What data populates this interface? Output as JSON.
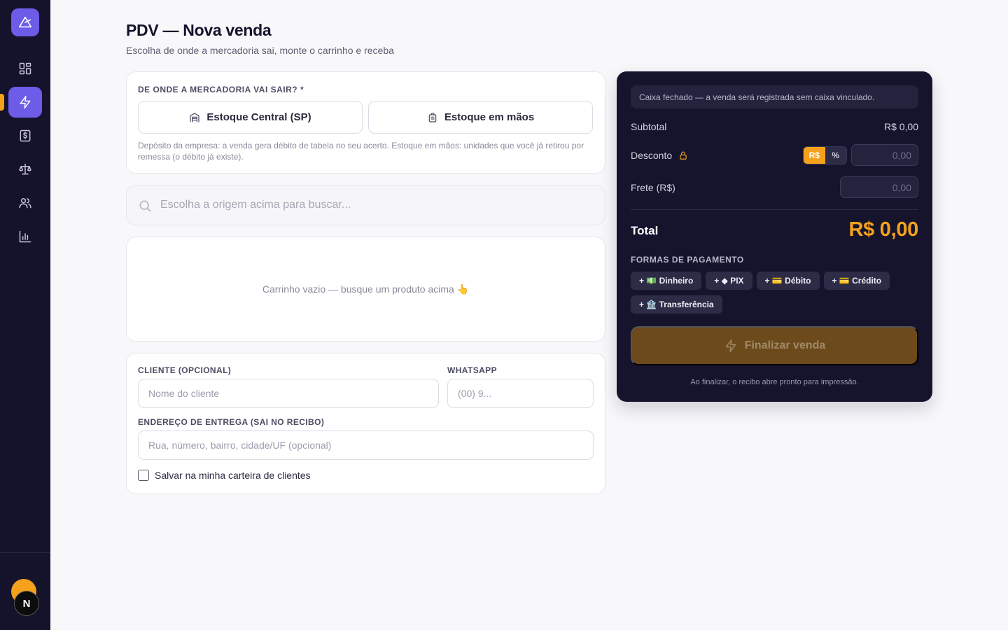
{
  "page": {
    "title": "PDV — Nova venda",
    "subtitle": "Escolha de onde a mercadoria sai, monte o carrinho e receba"
  },
  "sidebar": {
    "logo_icon": "triangle-logo-icon",
    "items": [
      {
        "icon": "dashboard-icon",
        "active": false
      },
      {
        "icon": "lightning-icon",
        "active": true
      },
      {
        "icon": "dollar-receipt-icon",
        "active": false
      },
      {
        "icon": "scale-icon",
        "active": false
      },
      {
        "icon": "users-icon",
        "active": false
      },
      {
        "icon": "bar-chart-icon",
        "active": false
      }
    ],
    "badge_letter": "N",
    "accent_color": "#6c5ce7",
    "marker_color": "#f5a11c"
  },
  "origin": {
    "label": "De onde a mercadoria vai sair? *",
    "options": [
      "Estoque Central (SP)",
      "Estoque em mãos"
    ],
    "help": "Depósito da empresa: a venda gera débito de tabela no seu acerto. Estoque em mãos: unidades que você já retirou por remessa (o débito já existe)."
  },
  "search": {
    "placeholder": "Escolha a origem acima para buscar..."
  },
  "cart": {
    "empty_text": "Carrinho vazio — busque um produto acima 👆"
  },
  "client": {
    "name_label": "CLIENTE (OPCIONAL)",
    "name_placeholder": "Nome do cliente",
    "whatsapp_label": "WHATSAPP",
    "whatsapp_placeholder": "(00) 9...",
    "address_label": "ENDEREÇO DE ENTREGA (SAI NO RECIBO)",
    "address_placeholder": "Rua, número, bairro, cidade/UF (opcional)",
    "save_label": "Salvar na minha carteira de clientes",
    "save_checked": false
  },
  "payment": {
    "notice": "Caixa fechado — a venda será registrada sem caixa vinculado.",
    "subtotal_label": "Subtotal",
    "subtotal_value": "R$ 0,00",
    "discount_label": "Desconto",
    "discount_modes": [
      "R$",
      "%"
    ],
    "discount_mode_selected": "R$",
    "discount_placeholder": "0,00",
    "shipping_label": "Frete (R$)",
    "shipping_placeholder": "0,00",
    "total_label": "Total",
    "total_value": "R$ 0,00",
    "methods_title": "FORMAS DE PAGAMENTO",
    "methods": [
      "+ 💵 Dinheiro",
      "+ ◆ PIX",
      "+ 💳 Débito",
      "+ 💳 Crédito",
      "+ 🏦 Transferência"
    ],
    "finalize_label": "Finalizar venda",
    "finalize_note": "Ao finalizar, o recibo abre pronto para impressão.",
    "accent_color": "#f5a11c"
  }
}
